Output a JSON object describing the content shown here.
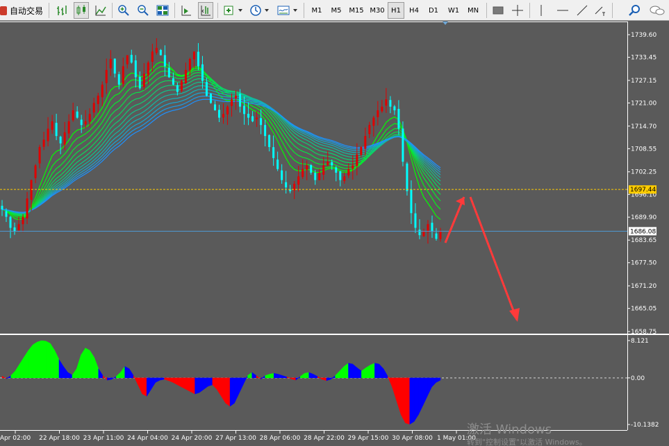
{
  "toolbar": {
    "auto_trading_label": "自动交易",
    "timeframes": [
      "M1",
      "M5",
      "M15",
      "M30",
      "H1",
      "H4",
      "D1",
      "W1",
      "MN"
    ],
    "active_timeframe": "H1",
    "icons": [
      "bar-chart-icon",
      "candlestick-icon",
      "line-chart-icon",
      "zoom-in-icon",
      "zoom-out-icon",
      "tile-windows-icon",
      "scroll-chart-icon",
      "chart-shift-icon",
      "add-indicator-icon",
      "periods-clock-icon",
      "templates-icon",
      "rectangle-icon",
      "crosshair-icon",
      "vertical-line-icon",
      "horizontal-line-icon",
      "trendline-icon",
      "text-label-icon",
      "search-icon",
      "chat-icon"
    ]
  },
  "price_axis": {
    "ticks": [
      "1739.60",
      "1733.45",
      "1727.15",
      "1721.00",
      "1714.70",
      "1708.55",
      "1702.25",
      "1696.10",
      "1689.90",
      "1683.65",
      "1677.50",
      "1671.20",
      "1665.05",
      "1658.75"
    ],
    "bid_label": "1686.08",
    "bid_line": 1686.08,
    "marker_label": "1697.44",
    "marker_line": 1697.44,
    "range": [
      1658.75,
      1739.6
    ]
  },
  "osc_axis": {
    "ticks": [
      "8.121",
      "0.00",
      "-10.1382"
    ],
    "range": [
      -10.1382,
      8.121
    ]
  },
  "time_axis": [
    "Apr 02:00",
    "22 Apr 18:00",
    "23 Apr 11:00",
    "24 Apr 04:00",
    "24 Apr 20:00",
    "27 Apr 13:00",
    "28 Apr 06:00",
    "28 Apr 22:00",
    "29 Apr 15:00",
    "30 Apr 08:00",
    "1 May 01:00"
  ],
  "watermark": {
    "line1": "激活 Windows",
    "line2": "转到\"控制设置\"以激活 Windows。"
  },
  "colors": {
    "bull": "#e00000",
    "bear": "#00ffff",
    "ribbon_top": "#00ff00",
    "ribbon_bottom": "#1e90ff",
    "osc_up": "#00ff00",
    "osc_down": "#0000ff",
    "osc_red": "#ff0000",
    "marker": "#ffcc00",
    "bid": "#4f9bd6",
    "arrow": "#ff3a3a"
  },
  "chart_data": {
    "type": "candlestick",
    "timeframe": "H1",
    "closes": [
      1692,
      1690,
      1687,
      1686,
      1688,
      1690,
      1695,
      1700,
      1704,
      1709,
      1711,
      1714,
      1716,
      1712,
      1710,
      1713,
      1716,
      1719,
      1717,
      1715,
      1716,
      1718,
      1721,
      1723,
      1726,
      1730,
      1733,
      1729,
      1726,
      1731,
      1734,
      1732,
      1728,
      1725,
      1729,
      1732,
      1735,
      1736,
      1734,
      1731,
      1728,
      1726,
      1724,
      1727,
      1730,
      1733,
      1735,
      1731,
      1727,
      1723,
      1721,
      1719,
      1717,
      1718,
      1720,
      1722,
      1723,
      1720,
      1718,
      1717,
      1716,
      1717,
      1715,
      1712,
      1709,
      1706,
      1703,
      1700,
      1698,
      1697,
      1699,
      1701,
      1703,
      1704,
      1702,
      1700,
      1702,
      1704,
      1705,
      1704,
      1702,
      1700,
      1701,
      1703,
      1704,
      1707,
      1709,
      1712,
      1715,
      1717,
      1719,
      1720,
      1722,
      1720,
      1719,
      1714,
      1705,
      1697,
      1691,
      1687,
      1685,
      1686,
      1688,
      1686,
      1684,
      1686
    ],
    "oscillator": [
      0.4,
      -0.2,
      0.5,
      1.5,
      3.0,
      4.5,
      6.0,
      7.2,
      7.8,
      8.1,
      8.0,
      7.5,
      6.0,
      4.0,
      2.5,
      1.2,
      0.6,
      2.0,
      5.0,
      6.5,
      6.0,
      4.5,
      2.0,
      0.5,
      -0.5,
      -0.3,
      0.3,
      1.2,
      2.5,
      2.0,
      0.5,
      -1.5,
      -3.5,
      -4.0,
      -2.5,
      -1.0,
      -0.5,
      -0.3,
      -0.6,
      -1.0,
      -1.5,
      -2.0,
      -2.5,
      -3.0,
      -3.5,
      -3.2,
      -2.5,
      -1.8,
      -1.5,
      -2.5,
      -4.0,
      -5.5,
      -6.2,
      -5.5,
      -3.5,
      -1.5,
      0.5,
      1.2,
      0.5,
      -0.3,
      0.5,
      0.8,
      1.0,
      0.8,
      0.5,
      0.2,
      -0.2,
      -0.5,
      0.3,
      1.0,
      1.2,
      0.8,
      0.3,
      -0.3,
      -0.6,
      -0.3,
      0.5,
      1.5,
      2.5,
      3.2,
      3.0,
      2.2,
      1.5,
      2.2,
      2.8,
      3.2,
      3.0,
      2.0,
      0.3,
      -2.0,
      -5.0,
      -8.0,
      -9.8,
      -10.1,
      -9.5,
      -8.0,
      -6.0,
      -4.0,
      -2.0,
      -1.0,
      -0.5
    ],
    "ribbon_lines": 12
  }
}
